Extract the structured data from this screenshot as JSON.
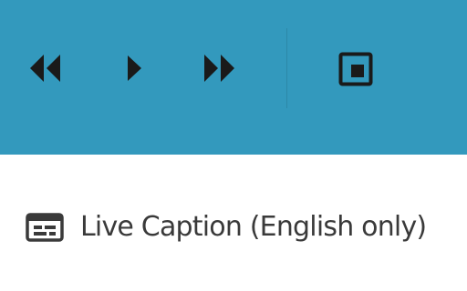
{
  "media_controls": {
    "background_color": "#3399bd",
    "icon_color": "#1a1a1a",
    "buttons": [
      {
        "name": "rewind",
        "icon": "rewind-icon"
      },
      {
        "name": "play",
        "icon": "play-icon"
      },
      {
        "name": "fast-forward",
        "icon": "fast-forward-icon"
      },
      {
        "name": "picture-in-picture",
        "icon": "picture-in-picture-icon"
      }
    ]
  },
  "captions": {
    "icon": "closed-caption-icon",
    "label": "Live Caption (English only)"
  }
}
